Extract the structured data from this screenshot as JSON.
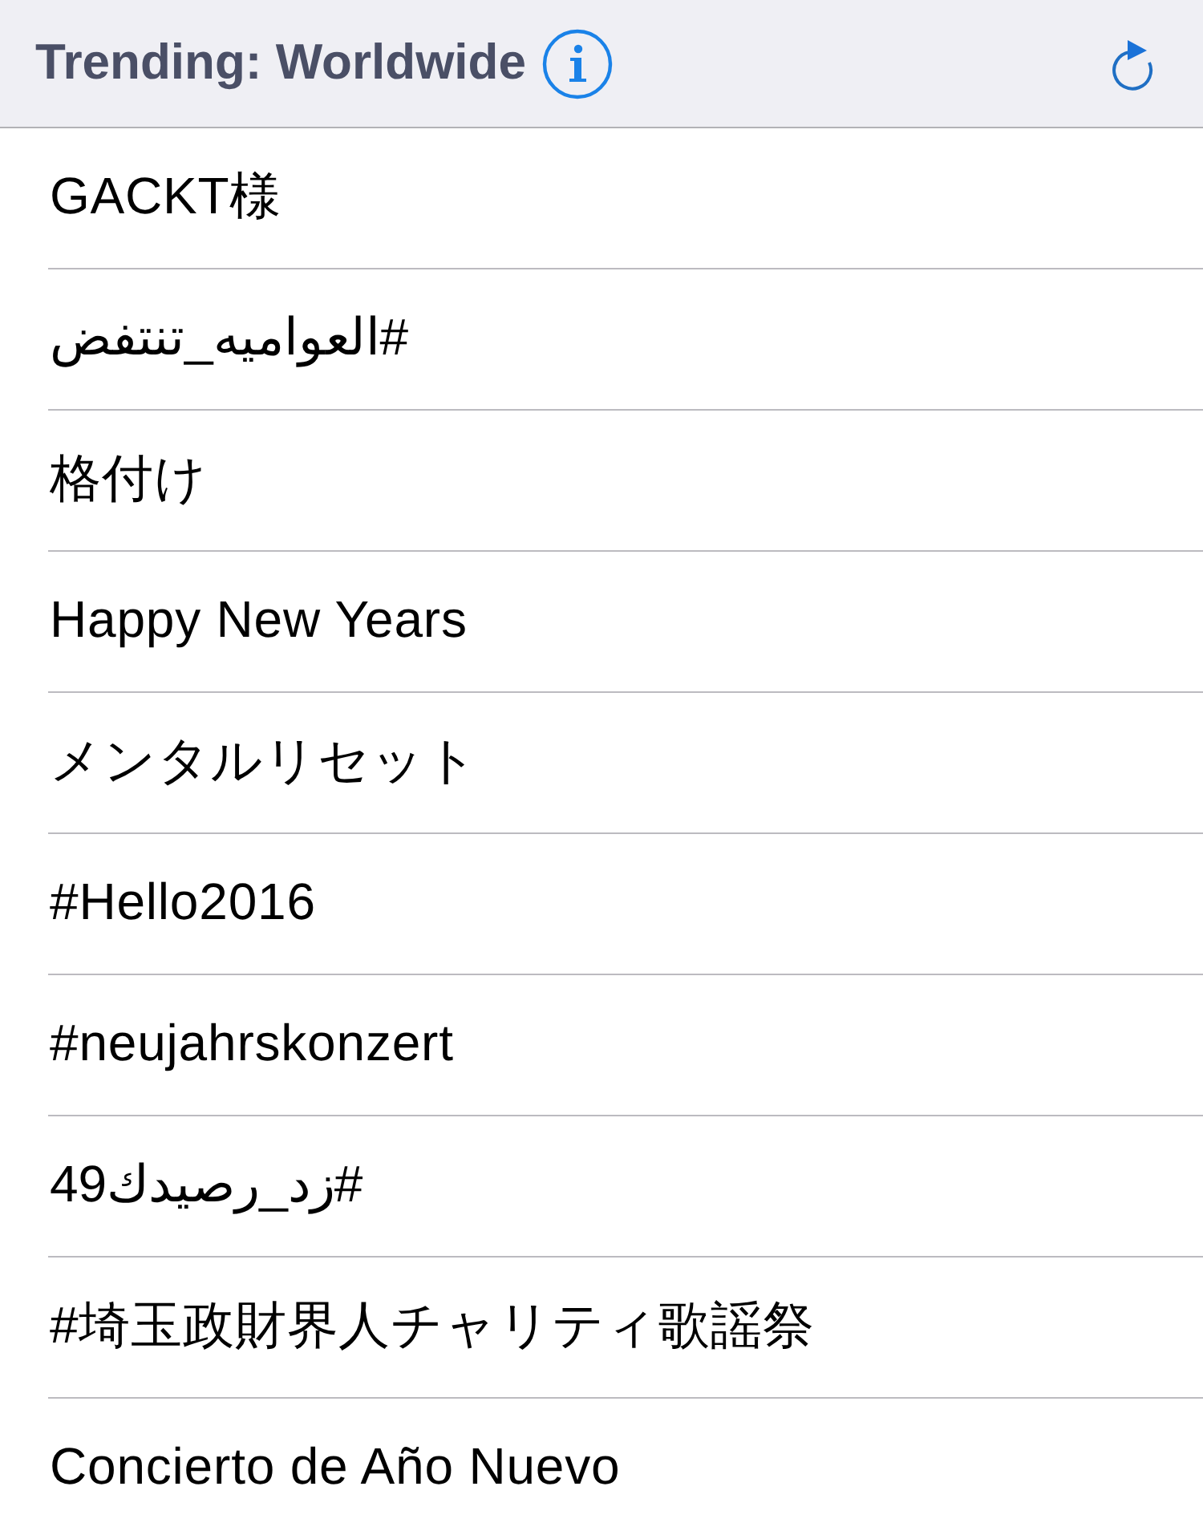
{
  "header": {
    "title": "Trending: Worldwide"
  },
  "trends": [
    {
      "label": "GACKT様"
    },
    {
      "label": "#العواميه_تنتفض"
    },
    {
      "label": "格付け"
    },
    {
      "label": "Happy New Years"
    },
    {
      "label": "メンタルリセット"
    },
    {
      "label": "#Hello2016"
    },
    {
      "label": "#neujahrskonzert"
    },
    {
      "label": "#زد_رصيدك49"
    },
    {
      "label": "#埼玉政財界人チャリティ歌謡祭"
    },
    {
      "label": "Concierto de Año Nuevo"
    }
  ]
}
